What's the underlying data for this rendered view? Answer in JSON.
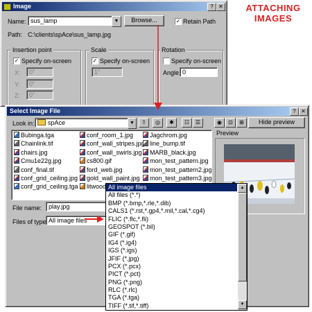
{
  "image_dialog": {
    "title": "Image",
    "name_label": "Name:",
    "name_value": "sus_lamp",
    "browse_label": "Browse...",
    "retain_path_label": "Retain Path",
    "retain_path_checked": true,
    "path_label": "Path:",
    "path_value": "C:\\clients\\spAce\\sus_lamp.jpg",
    "insertion": {
      "title": "Insertion point",
      "specify_label": "Specify on-screen",
      "x_label": "X:",
      "x_value": "0\"",
      "y_label": "Y:",
      "y_value": "0\"",
      "z_label": "Z:",
      "z_value": "0\""
    },
    "scale": {
      "title": "Scale",
      "specify_label": "Specify on-screen",
      "value": "1\""
    },
    "rotation": {
      "title": "Rotation",
      "specify_label": "Specify on-screen",
      "angle_label": "Angle:",
      "angle_value": "0"
    }
  },
  "annotation": {
    "line1": "ATTACHING",
    "line2": "IMAGES",
    "color": "#e02020"
  },
  "select_dialog": {
    "title": "Select Image File",
    "look_in_label": "Look in:",
    "look_in_value": "spAce",
    "hide_preview_label": "Hide preview",
    "preview_label": "Preview",
    "files": [
      {
        "name": "Bubinga.tga",
        "icon": "tga"
      },
      {
        "name": "Chainlink.tif",
        "icon": "tif"
      },
      {
        "name": "chairs.jpg",
        "icon": "jpg"
      },
      {
        "name": "Cmu1e22g.jpg",
        "icon": "jpg"
      },
      {
        "name": "conf_final.tif",
        "icon": "tif"
      },
      {
        "name": "conf_grid_ceiling.jpg",
        "icon": "jpg"
      },
      {
        "name": "conf_grid_ceiling.tga",
        "icon": "tga"
      },
      {
        "name": "conf_room_1.jpg",
        "icon": "jpg"
      },
      {
        "name": "conf_wall_stripes.jpg",
        "icon": "jpg"
      },
      {
        "name": "conf_wall_swirls.jpg",
        "icon": "jpg"
      },
      {
        "name": "cs800.gif",
        "icon": "gif"
      },
      {
        "name": "ford_web.jpg",
        "icon": "jpg"
      },
      {
        "name": "gold_wall_paint.jpg",
        "icon": "jpg"
      },
      {
        "name": "litwood1.gif",
        "icon": "gif"
      },
      {
        "name": "Jagchrom.jpg",
        "icon": "jpg"
      },
      {
        "name": "line_bump.tif",
        "icon": "tif"
      },
      {
        "name": "MARB_black.jpg",
        "icon": "jpg"
      },
      {
        "name": "mon_test_pattern.jpg",
        "icon": "jpg"
      },
      {
        "name": "mon_test_pattern2.jpg",
        "icon": "jpg"
      },
      {
        "name": "mon_test_pattern3.jpg",
        "icon": "jpg"
      },
      {
        "name": "play.jpg",
        "icon": "jpg"
      }
    ],
    "file_name_label": "File name:",
    "file_name_value": "play.jpg",
    "files_of_type_label": "Files of type:",
    "files_of_type_value": "All image files"
  },
  "type_dropdown": {
    "selected_index": 0,
    "options": [
      "All image files",
      "All files (*.*)",
      "BMP (*.bmp,*.rle,*.dib)",
      "CALS1 (*.rst,*.gp4,*.mil,*.cal,*.cg4)",
      "FLIC (*.flc,*.fli)",
      "GEOSPOT (*.bil)",
      "GIF (*.gif)",
      "IG4 (*.ig4)",
      "IGS (*.igs)",
      "JFIF (*.jpg)",
      "PCX (*.pcx)",
      "PICT (*.pct)",
      "PNG (*.png)",
      "RLC (*.rlc)",
      "TGA (*.tga)",
      "TIFF (*.tif,*.tiff)"
    ]
  }
}
